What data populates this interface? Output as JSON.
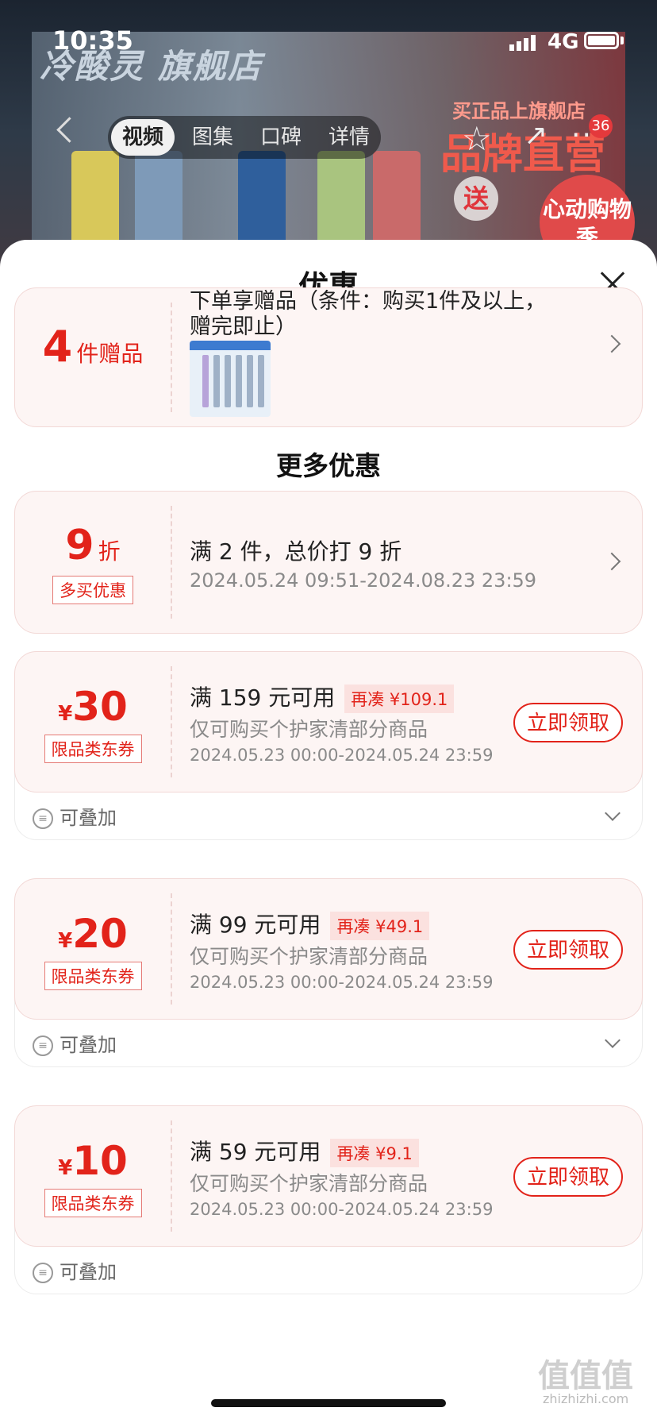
{
  "status": {
    "time": "10:35",
    "network": "4G"
  },
  "banner": {
    "brand": "冷酸灵 旗舰店",
    "promo_small": "买正品上旗舰店",
    "promo_big": "品牌直营",
    "gift": "送",
    "heart": "心动购物季"
  },
  "nav": {
    "tabs": [
      "视频",
      "图集",
      "口碑",
      "详情"
    ],
    "active_tab": 0,
    "cart_count": "36"
  },
  "sheet": {
    "title": "优惠"
  },
  "gift_card": {
    "count": "4",
    "label": "件赠品",
    "desc_line1": "下单享赠品（条件：购买1件及以上，",
    "desc_line2": "赠完即止）"
  },
  "more": {
    "title": "更多优惠"
  },
  "discount": {
    "value": "9",
    "unit": "折",
    "tag": "多买优惠",
    "condition": "满 2 件，总价打 9 折",
    "period": "2024.05.24 09:51-2024.08.23 23:59"
  },
  "coupons": [
    {
      "currency": "¥",
      "amount": "30",
      "tag": "限品类东券",
      "condition": "满 159 元可用",
      "need": "再凑 ¥109.1",
      "scope": "仅可购买个护家清部分商品",
      "period": "2024.05.23 00:00-2024.05.24 23:59",
      "button": "立即领取",
      "stack": "可叠加"
    },
    {
      "currency": "¥",
      "amount": "20",
      "tag": "限品类东券",
      "condition": "满 99 元可用",
      "need": "再凑 ¥49.1",
      "scope": "仅可购买个护家清部分商品",
      "period": "2024.05.23 00:00-2024.05.24 23:59",
      "button": "立即领取",
      "stack": "可叠加"
    },
    {
      "currency": "¥",
      "amount": "10",
      "tag": "限品类东券",
      "condition": "满 59 元可用",
      "need": "再凑 ¥9.1",
      "scope": "仅可购买个护家清部分商品",
      "period": "2024.05.23 00:00-2024.05.24 23:59",
      "button": "立即领取",
      "stack": "可叠加"
    }
  ],
  "watermark": {
    "main": "值值值",
    "sub": "zhizhizhi.com"
  },
  "colors": {
    "accent": "#e2231a",
    "card_bg": "#fdf5f4"
  }
}
